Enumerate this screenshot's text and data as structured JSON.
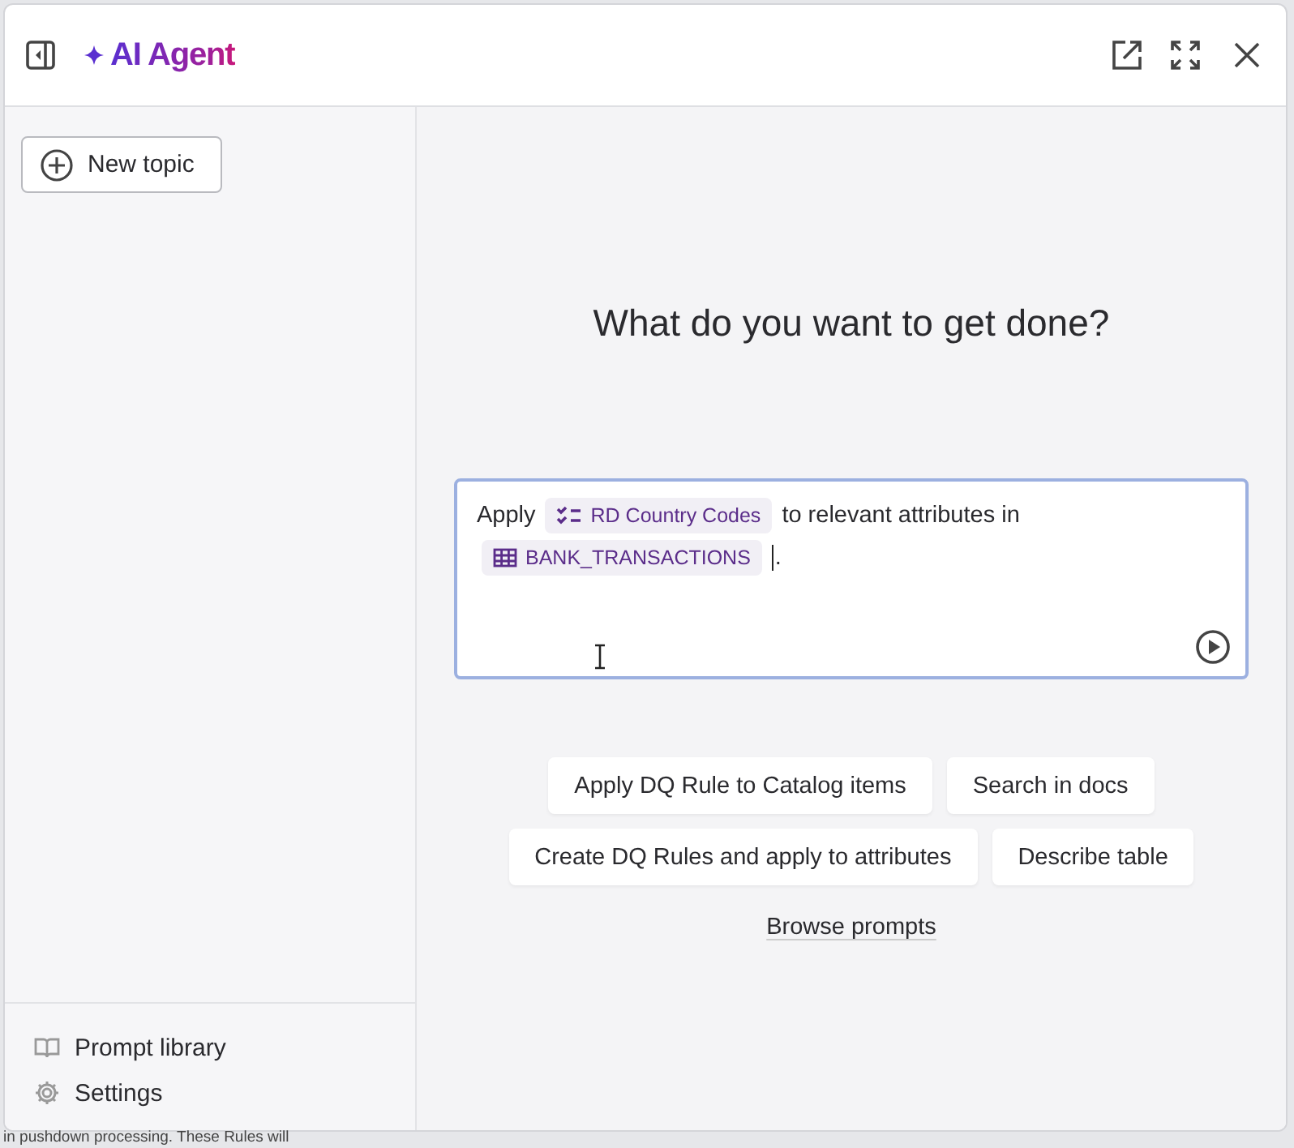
{
  "header": {
    "title": "AI Agent"
  },
  "sidebar": {
    "new_topic": "New topic",
    "footer_items": [
      {
        "kind": "library",
        "label": "Prompt library"
      },
      {
        "kind": "settings",
        "label": "Settings"
      }
    ]
  },
  "main": {
    "heading": "What do you want to get done?",
    "prompt": {
      "segments": [
        {
          "kind": "text",
          "text": "Apply"
        },
        {
          "kind": "rule",
          "text": "RD Country Codes"
        },
        {
          "kind": "text",
          "text": "to relevant attributes in"
        },
        {
          "kind": "table",
          "text": "BANK_TRANSACTIONS"
        },
        {
          "kind": "text",
          "text": "."
        }
      ]
    },
    "suggestion_rows": [
      [
        "Apply DQ Rule to Catalog items",
        "Search in docs"
      ],
      [
        "Create DQ Rules and apply to attributes",
        "Describe table"
      ]
    ],
    "browse": "Browse prompts"
  },
  "background_text": "in pushdown processing. These Rules will"
}
